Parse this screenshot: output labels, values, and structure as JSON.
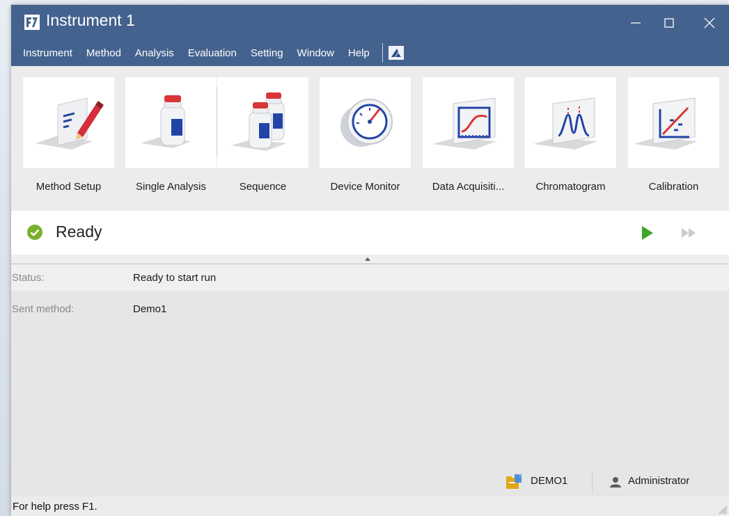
{
  "window": {
    "title": "Instrument 1",
    "accent": "#44628e"
  },
  "menu": {
    "items": [
      "Instrument",
      "Method",
      "Analysis",
      "Evaluation",
      "Setting",
      "Window",
      "Help"
    ]
  },
  "toolbar": {
    "tools": [
      {
        "label": "Method Setup",
        "icon": "method-setup-icon"
      },
      {
        "label": "Single Analysis",
        "icon": "single-analysis-icon"
      },
      {
        "label": "Sequence",
        "icon": "sequence-icon"
      },
      {
        "label": "Device Monitor",
        "icon": "device-monitor-icon"
      },
      {
        "label": "Data Acquisiti...",
        "icon": "data-acquisition-icon"
      },
      {
        "label": "Chromatogram",
        "icon": "chromatogram-icon"
      },
      {
        "label": "Calibration",
        "icon": "calibration-icon"
      }
    ]
  },
  "status_header": {
    "state": "Ready",
    "state_color": "#7ab02d"
  },
  "details": {
    "rows": [
      {
        "label": "Status:",
        "value": "Ready to start run"
      },
      {
        "label": "Sent method:",
        "value": "Demo1"
      }
    ]
  },
  "bottom": {
    "project": "DEMO1",
    "user": "Administrator"
  },
  "footer": {
    "help_text": "For help press F1."
  }
}
